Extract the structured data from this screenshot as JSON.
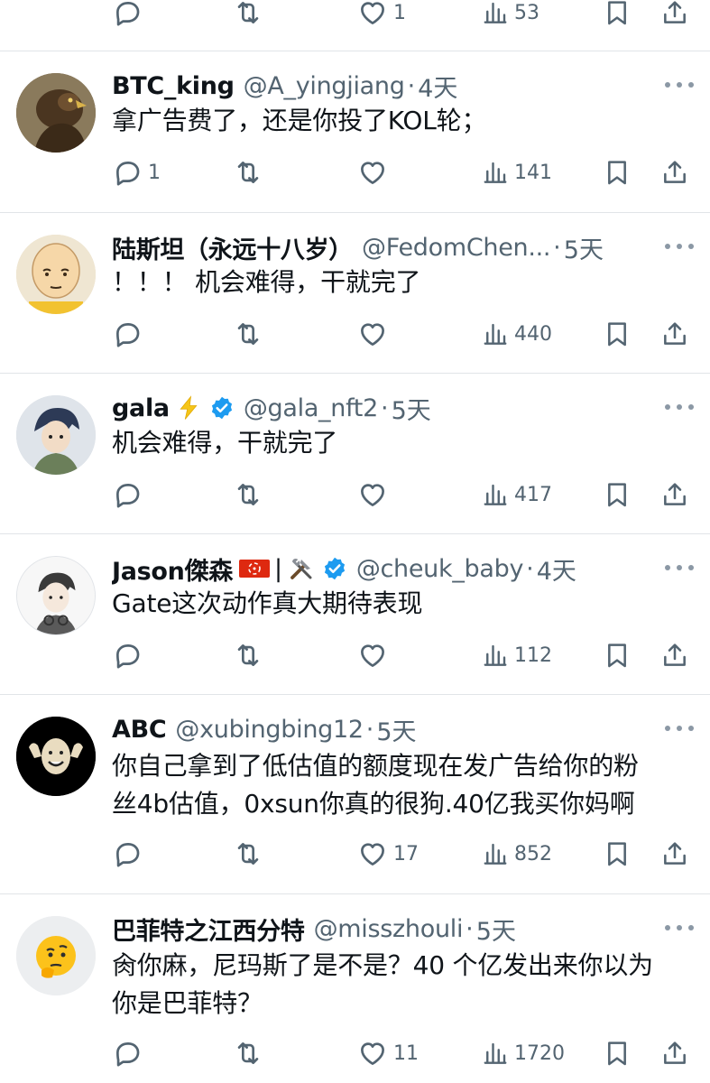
{
  "top_actions": {
    "reply": "",
    "retweet": "",
    "like": "1",
    "views": "53"
  },
  "tweets": [
    {
      "name": "BTC_king",
      "handle": "@A_yingjiang",
      "dot": "·",
      "time": "4天",
      "text": "拿广告费了，还是你投了KOL轮；",
      "counts": {
        "reply": "1",
        "retweet": "",
        "like": "",
        "views": "141"
      },
      "avatar": "eagle-avatar"
    },
    {
      "name": "陆斯坦（永远十八岁）",
      "handle": "@FedomChen...",
      "dot": "·",
      "time": "5天",
      "text": "！！！ 机会难得，干就完了",
      "counts": {
        "reply": "",
        "retweet": "",
        "like": "",
        "views": "440"
      },
      "avatar": "bald-hero-avatar"
    },
    {
      "name": "gala",
      "handle": "@gala_nft2",
      "dot": "·",
      "time": "5天",
      "text": "机会难得，干就完了",
      "counts": {
        "reply": "",
        "retweet": "",
        "like": "",
        "views": "417"
      },
      "avatar": "anime-boy-avatar",
      "name_emoji": "lightning-emoji",
      "verified": true
    },
    {
      "name": "Jason傑森",
      "handle": "@cheuk_baby",
      "dot": "·",
      "time": "4天",
      "text": "Gate这次动作真大期待表现",
      "counts": {
        "reply": "",
        "retweet": "",
        "like": "",
        "views": "112"
      },
      "avatar": "sketch-boy-avatar",
      "name_suffix": "|",
      "name_emoji": "hk-flag-emoji",
      "name_emoji2": "tools-emoji",
      "verified": true
    },
    {
      "name": "ABC",
      "handle": "@xubingbing12",
      "dot": "·",
      "time": "5天",
      "text_lines": [
        "你自己拿到了低估值的额度现在发广告给你的粉",
        "丝4b估值，0xsun你真的很狗.40亿我买你妈啊"
      ],
      "counts": {
        "reply": "",
        "retweet": "",
        "like": "17",
        "views": "852"
      },
      "avatar": "laughing-man-avatar"
    },
    {
      "name": "巴菲特之江西分特",
      "handle": "@misszhouli",
      "dot": "·",
      "time": "5天",
      "text_lines": [
        "肏你麻，尼玛斯了是不是？40 个亿发出来你以为",
        "你是巴菲特？"
      ],
      "counts": {
        "reply": "",
        "retweet": "",
        "like": "11",
        "views": "1720"
      },
      "avatar": "thinking-face-avatar"
    }
  ],
  "colors": {
    "text": "#0f1419",
    "secondary": "#536471",
    "verified": "#1d9bf0",
    "divider": "#e1e4e8"
  }
}
